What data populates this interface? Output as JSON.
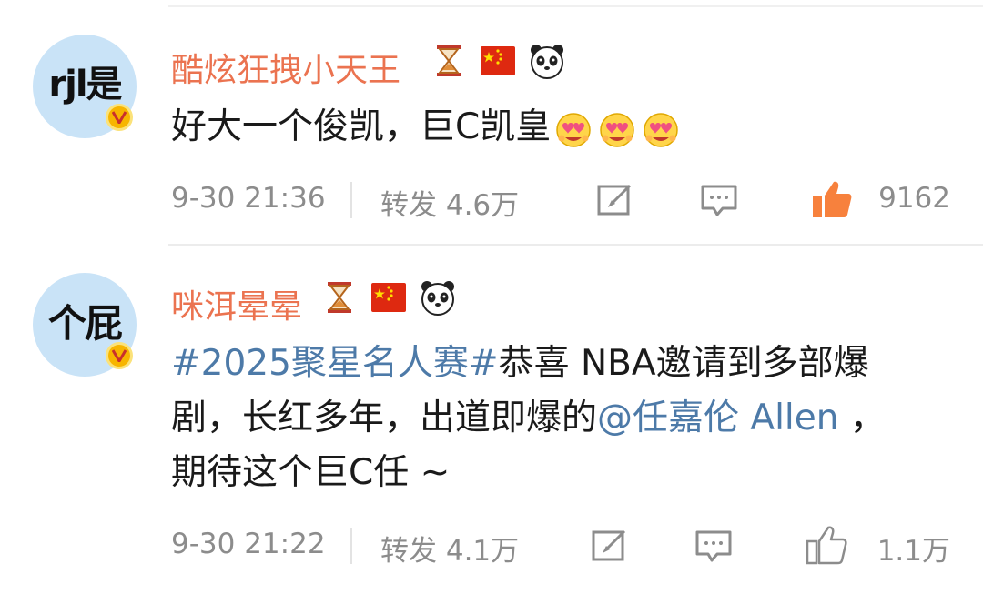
{
  "comments": [
    {
      "avatar_text": "rjl是",
      "username": "酷炫狂拽小天王",
      "text": "好大一个俊凯，巨C凯皇",
      "emoji_count": 3,
      "time": "9-30 21:36",
      "repost": "转发 4.6万",
      "likes": "9162",
      "liked": true
    },
    {
      "avatar_text": "个屁",
      "username": "咪洱晕晕",
      "topic": "#2025聚星名人赛#",
      "text_part1": "恭喜 NBA邀请到多部爆剧，长红多年，出道即爆的",
      "mention": "@任嘉伦 Allen",
      "text_part2": " ，期待这个巨C任 ~",
      "time": "9-30 21:22",
      "repost": "转发 4.1万",
      "likes": "1.1万",
      "liked": false
    }
  ],
  "icons": [
    "verified-v-icon",
    "hourglass-icon",
    "china-flag-icon",
    "panda-icon",
    "heart-eyes-emoji-icon",
    "edit-share-icon",
    "comment-icon",
    "thumbs-up-icon"
  ],
  "colors": {
    "username": "#eb7350",
    "link": "#4d7aa8",
    "meta": "#8c8c8c",
    "like_active": "#f7813d",
    "avatar_bg": "#c9e3f7"
  }
}
